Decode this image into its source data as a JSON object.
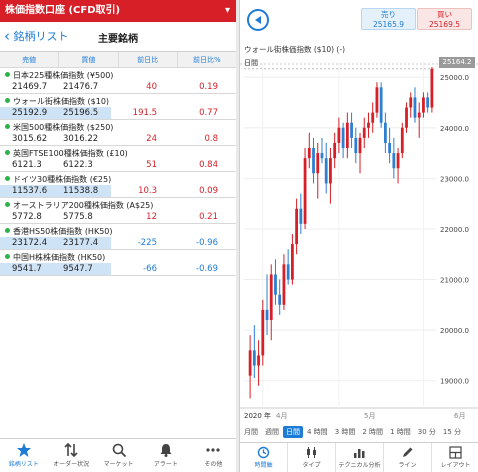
{
  "left": {
    "title": "株価指数口座 (CFD取引)",
    "back_label": "銘柄リスト",
    "nav_title": "主要銘柄",
    "columns": [
      "売値",
      "買値",
      "前日比",
      "前日比%"
    ],
    "rows": [
      {
        "name": "日本225種株価指数 (¥500)",
        "bid": "21469.7",
        "ask": "21476.7",
        "change": "40",
        "pct": "0.19",
        "dir": "up",
        "highlight": false
      },
      {
        "name": "ウォール街株価指数 ($10)",
        "bid": "25192.9",
        "ask": "25196.5",
        "change": "191.5",
        "pct": "0.77",
        "dir": "up",
        "highlight": true
      },
      {
        "name": "米国500種株価指数 ($250)",
        "bid": "3015.62",
        "ask": "3016.22",
        "change": "24",
        "pct": "0.8",
        "dir": "up",
        "highlight": false
      },
      {
        "name": "英国FTSE100種株価指数 (£10)",
        "bid": "6121.3",
        "ask": "6122.3",
        "change": "51",
        "pct": "0.84",
        "dir": "up",
        "highlight": false
      },
      {
        "name": "ドイツ30種株価指数 (€25)",
        "bid": "11537.6",
        "ask": "11538.8",
        "change": "10.3",
        "pct": "0.09",
        "dir": "up",
        "highlight": true
      },
      {
        "name": "オーストラリア200種株価指数 (A$25)",
        "bid": "5772.8",
        "ask": "5775.8",
        "change": "12",
        "pct": "0.21",
        "dir": "up",
        "highlight": false
      },
      {
        "name": "香港HS50株価指数 (HK50)",
        "bid": "23172.4",
        "ask": "23177.4",
        "change": "-225",
        "pct": "-0.96",
        "dir": "down",
        "highlight": true
      },
      {
        "name": "中国H株株価指数 (HK50)",
        "bid": "9541.7",
        "ask": "9547.7",
        "change": "-66",
        "pct": "-0.69",
        "dir": "down",
        "highlight": true
      }
    ],
    "tabs": [
      {
        "label": "銘柄リスト",
        "icon": "star-icon"
      },
      {
        "label": "オーダー状況",
        "icon": "transfer-arrows-icon"
      },
      {
        "label": "マーケット",
        "icon": "search-icon"
      },
      {
        "label": "アラート",
        "icon": "bell-icon"
      },
      {
        "label": "その他",
        "icon": "more-dots-icon"
      }
    ]
  },
  "right": {
    "sell": {
      "label": "売り",
      "value": "25165.9"
    },
    "buy": {
      "label": "買い",
      "value": "25169.5"
    },
    "symbol": "ウォール街株価指数 ($10) (-)",
    "grid_label": "日間",
    "current_price": "25164.2",
    "periods": [
      "月間",
      "週間",
      "日間",
      "4 時間",
      "3 時間",
      "2 時間",
      "1 時間",
      "30 分",
      "15 分"
    ],
    "active_period": "日間",
    "tabs": [
      {
        "label": "時間軸",
        "icon": "clock-icon"
      },
      {
        "label": "タイプ",
        "icon": "candles-icon"
      },
      {
        "label": "テクニカル分析",
        "icon": "bars-icon"
      },
      {
        "label": "ライン",
        "icon": "pencil-icon"
      },
      {
        "label": "レイアウト",
        "icon": "layout-icon"
      }
    ]
  },
  "chart_data": {
    "type": "candlestick",
    "ylim": [
      18500,
      25300
    ],
    "yticks": [
      "25000.0",
      "24000.0",
      "23000.0",
      "22000.0",
      "21000.0",
      "20000.0",
      "19000.0"
    ],
    "yvals": [
      25000,
      24000,
      23000,
      22000,
      21000,
      20000,
      19000
    ],
    "xticks": [
      "2020 年",
      "4月",
      "5月",
      "6月"
    ],
    "candles": [
      [
        19100,
        19900,
        18650,
        19600
      ],
      [
        19600,
        20100,
        19050,
        19300
      ],
      [
        19300,
        19800,
        18900,
        19500
      ],
      [
        19500,
        20600,
        19300,
        20400
      ],
      [
        20400,
        21100,
        19900,
        20200
      ],
      [
        20200,
        21300,
        19800,
        21100
      ],
      [
        21100,
        21400,
        20500,
        20700
      ],
      [
        20700,
        21000,
        20300,
        20500
      ],
      [
        20500,
        21500,
        20400,
        21300
      ],
      [
        21300,
        21600,
        20900,
        21000
      ],
      [
        21000,
        21900,
        20900,
        21700
      ],
      [
        21700,
        22600,
        21500,
        22400
      ],
      [
        22400,
        22700,
        21900,
        22100
      ],
      [
        22100,
        23600,
        22000,
        23400
      ],
      [
        23400,
        23900,
        23200,
        23600
      ],
      [
        23600,
        23800,
        22900,
        23100
      ],
      [
        23100,
        23700,
        22600,
        23500
      ],
      [
        23500,
        23800,
        23300,
        23400
      ],
      [
        23400,
        23700,
        22700,
        22900
      ],
      [
        22900,
        23600,
        22500,
        23400
      ],
      [
        23400,
        23900,
        23200,
        23700
      ],
      [
        23700,
        24200,
        23500,
        24000
      ],
      [
        24000,
        24100,
        23400,
        23600
      ],
      [
        23600,
        24300,
        23400,
        24100
      ],
      [
        24100,
        24300,
        23600,
        23800
      ],
      [
        23800,
        24000,
        23300,
        23500
      ],
      [
        23500,
        23900,
        23100,
        23800
      ],
      [
        23800,
        24200,
        23600,
        24000
      ],
      [
        24000,
        24300,
        23800,
        24100
      ],
      [
        24100,
        24500,
        23900,
        24300
      ],
      [
        24300,
        24900,
        24200,
        24800
      ],
      [
        24800,
        24900,
        24000,
        24100
      ],
      [
        24100,
        24300,
        23500,
        23700
      ],
      [
        23700,
        24000,
        23300,
        23500
      ],
      [
        23500,
        23800,
        23000,
        23200
      ],
      [
        23200,
        23600,
        22900,
        23500
      ],
      [
        23500,
        24100,
        23400,
        24000
      ],
      [
        24000,
        24500,
        23900,
        24400
      ],
      [
        24400,
        24700,
        24200,
        24600
      ],
      [
        24600,
        24800,
        24100,
        24200
      ],
      [
        24200,
        24500,
        23800,
        24300
      ],
      [
        24300,
        24700,
        24200,
        24600
      ],
      [
        24600,
        24700,
        24300,
        24400
      ],
      [
        24400,
        25200,
        24300,
        25164
      ]
    ]
  }
}
